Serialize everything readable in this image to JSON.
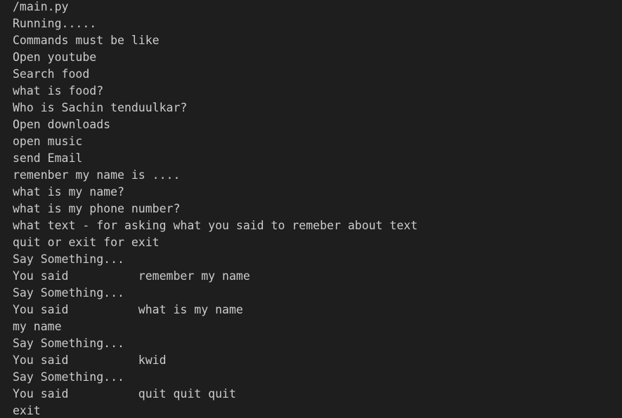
{
  "terminal": {
    "lines": [
      "/main.py",
      "Running.....",
      "Commands must be like",
      "Open youtube",
      "Search food",
      "what is food?",
      "Who is Sachin tenduulkar?",
      "Open downloads",
      "open music",
      "send Email",
      "remenber my name is ....",
      "what is my name?",
      "what is my phone number?",
      "what text - for asking what you said to remeber about text",
      "quit or exit for exit",
      "Say Something...",
      "You said          remember my name",
      "Say Something...",
      "You said          what is my name",
      "my name",
      "Say Something...",
      "You said          kwid",
      "Say Something...",
      "You said          quit quit quit",
      "exit"
    ]
  },
  "colors": {
    "background": "#1e1e1e",
    "text": "#cccccc"
  }
}
